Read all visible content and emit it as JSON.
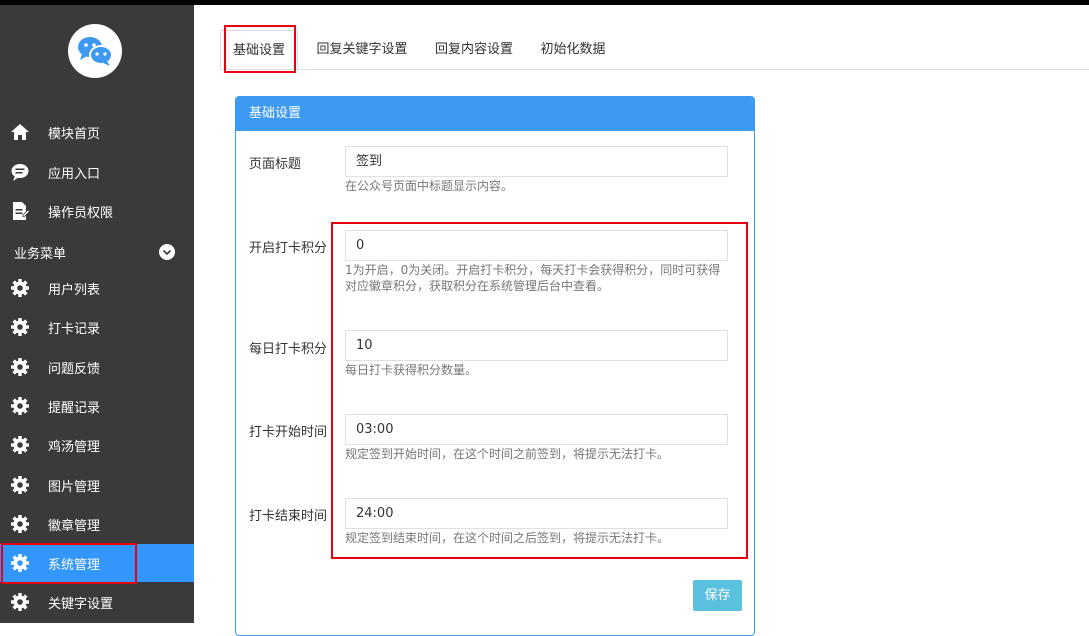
{
  "sidebar": {
    "logo_icon": "wechat-chat-icon",
    "top_items": [
      {
        "label": "模块首页",
        "icon": "home-icon"
      },
      {
        "label": "应用入口",
        "icon": "chat-bubble-icon"
      },
      {
        "label": "操作员权限",
        "icon": "document-edit-icon"
      }
    ],
    "section": {
      "label": "业务菜单",
      "icon": "chevron-down-icon"
    },
    "items": [
      {
        "label": "用户列表",
        "icon": "gear-icon"
      },
      {
        "label": "打卡记录",
        "icon": "gear-icon"
      },
      {
        "label": "问题反馈",
        "icon": "gear-icon"
      },
      {
        "label": "提醒记录",
        "icon": "gear-icon"
      },
      {
        "label": "鸡汤管理",
        "icon": "gear-icon"
      },
      {
        "label": "图片管理",
        "icon": "gear-icon"
      },
      {
        "label": "徽章管理",
        "icon": "gear-icon"
      },
      {
        "label": "系统管理",
        "icon": "gear-icon",
        "active": true
      },
      {
        "label": "关键字设置",
        "icon": "gear-icon"
      }
    ],
    "active_color": "#3296fa"
  },
  "tabs": [
    {
      "label": "基础设置",
      "active": true
    },
    {
      "label": "回复关键字设置"
    },
    {
      "label": "回复内容设置"
    },
    {
      "label": "初始化数据"
    }
  ],
  "panel": {
    "title": "基础设置",
    "fields": [
      {
        "label": "页面标题",
        "value": "签到",
        "help": "在公众号页面中标题显示内容。"
      },
      {
        "label": "开启打卡积分",
        "value": "0",
        "help": "1为开启，0为关闭。开启打卡积分，每天打卡会获得积分，同时可获得对应徽章积分，获取积分在系统管理后台中查看。"
      },
      {
        "label": "每日打卡积分",
        "value": "10",
        "help": "每日打卡获得积分数量。"
      },
      {
        "label": "打卡开始时间",
        "value": "03:00",
        "help": "规定签到开始时间，在这个时间之前签到，将提示无法打卡。"
      },
      {
        "label": "打卡结束时间",
        "value": "24:00",
        "help": "规定签到结束时间，在这个时间之后签到，将提示无法打卡。"
      }
    ],
    "save_label": "保存",
    "accent_color": "#3d9af2"
  },
  "highlight_color": "#e60012"
}
